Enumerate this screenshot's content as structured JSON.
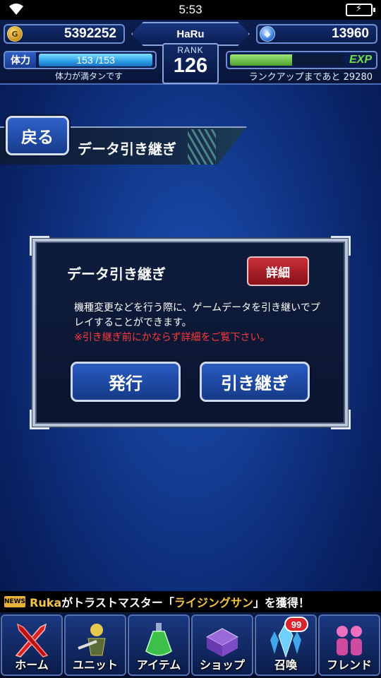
{
  "status_bar": {
    "time": "5:53"
  },
  "header": {
    "gil": "5392252",
    "gems": "13960",
    "player_name": "HaRu",
    "rank_label": "RANK",
    "rank_value": "126",
    "stamina_label": "体力",
    "stamina_text": "153 /153",
    "stamina_fraction": 1.0,
    "stamina_note": "体力が満タンです",
    "exp_label": "EXP",
    "exp_fraction": 0.55,
    "exp_note": "ランクアップまであと 29280"
  },
  "nav_top": {
    "back_label": "戻る",
    "screen_title": "データ引き継ぎ"
  },
  "dialog": {
    "title": "データ引き継ぎ",
    "detail_label": "詳細",
    "description": "機種変更などを行う際に、ゲームデータを引き継いでプレイすることができます。",
    "warning": "※引き継ぎ前にかならず詳細をご覧下さい。",
    "issue_label": "発行",
    "transfer_label": "引き継ぎ"
  },
  "news": {
    "badge": "NEWS",
    "name": "Ruka",
    "text_before": "がトラストマスター「",
    "highlight": "ライジングサン",
    "text_after": "」を獲得！"
  },
  "bottom_nav": {
    "items": [
      {
        "label": "ホーム",
        "icon": "sword-icon"
      },
      {
        "label": "ユニット",
        "icon": "warrior-icon"
      },
      {
        "label": "アイテム",
        "icon": "potion-icon"
      },
      {
        "label": "ショップ",
        "icon": "chest-icon"
      },
      {
        "label": "召喚",
        "icon": "crystal-icon"
      },
      {
        "label": "フレンド",
        "icon": "friends-icon"
      }
    ],
    "summon_badge": "99"
  },
  "colors": {
    "accent_blue": "#1d4fb3",
    "warning_red": "#ff3a3a",
    "detail_red": "#c7303a",
    "exp_green": "#6fe04a",
    "news_yellow": "#f4c542"
  }
}
